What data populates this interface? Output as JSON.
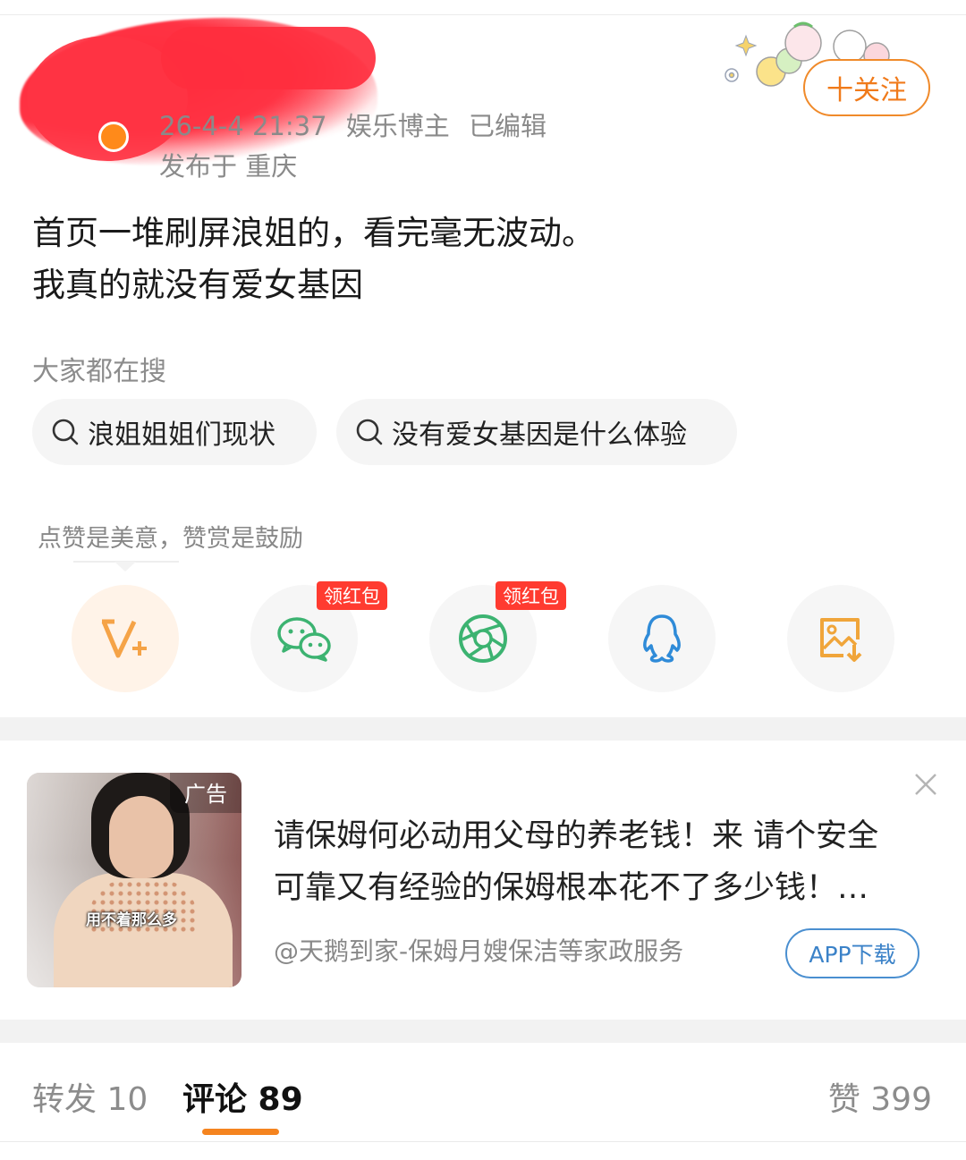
{
  "header": {
    "timestamp": "26-4-4 21:37",
    "role": "娱乐博主",
    "edited": "已编辑",
    "location": "发布于 重庆",
    "follow_label": "十关注"
  },
  "post": {
    "line1": "首页一堆刷屏浪姐的，看完毫无波动。",
    "line2": "我真的就没有爱女基因"
  },
  "search": {
    "label": "大家都在搜",
    "chips": [
      "浪姐姐姐们现状",
      "没有爱女基因是什么体验"
    ]
  },
  "reward": {
    "text": "点赞是美意，赞赏是鼓励",
    "red_packet_label": "领红包",
    "share_targets": [
      "v-plus-icon",
      "wechat-icon",
      "moments-icon",
      "qq-icon",
      "save-image-icon"
    ]
  },
  "ad": {
    "tag": "广告",
    "image_caption": "用不着那么多",
    "line1": "请保姆何必动用父母的养老钱！来 请个安全",
    "line2": "可靠又有经验的保姆根本花不了多少钱！…",
    "source": "@天鹅到家-保姆月嫂保洁等家政服务",
    "button": "APP下载"
  },
  "tabs": {
    "forward": "转发 10",
    "comments": "评论 89",
    "likes": "赞 399"
  },
  "colors": {
    "accent_orange": "#f07a1a",
    "red_packet": "#ff3b30",
    "wechat_green": "#3cb371",
    "qq_blue": "#2f8bd8",
    "ad_button_blue": "#3b82c8"
  }
}
